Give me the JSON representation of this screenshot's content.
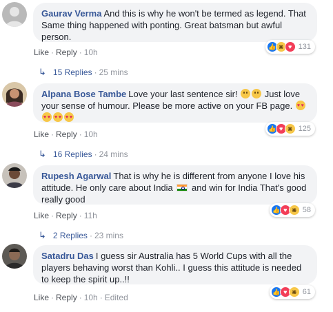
{
  "comments": [
    {
      "name": "Gaurav Verma",
      "text": "And this is why he won't be termed as legend. That Same thing happened with ponting. Great batsman but awful person.",
      "like": "Like",
      "reply": "Reply",
      "time": "10h",
      "edited": "",
      "reaction_count": "131",
      "reaction_icons": [
        "like-icon",
        "haha-icon",
        "love-icon"
      ],
      "replies_label": "15 Replies",
      "replies_time": "25 mins"
    },
    {
      "name": "Alpana Bose Tambe",
      "text_a": "Love your last sentence sir!",
      "text_b": "Just love your sense of humour. Please be more active on your FB page.",
      "like": "Like",
      "reply": "Reply",
      "time": "10h",
      "edited": "",
      "reaction_count": "125",
      "reaction_icons": [
        "like-icon",
        "love-icon",
        "haha-icon"
      ],
      "replies_label": "16 Replies",
      "replies_time": "24 mins"
    },
    {
      "name": "Rupesh Agarwal",
      "text_a": "That is why he is different from anyone I love his attitude. He only care about India",
      "text_b": "and win for India That's good really good",
      "like": "Like",
      "reply": "Reply",
      "time": "11h",
      "edited": "",
      "reaction_count": "58",
      "reaction_icons": [
        "like-icon",
        "love-icon",
        "haha-icon"
      ],
      "replies_label": "2 Replies",
      "replies_time": "23 mins"
    },
    {
      "name": "Satadru Das",
      "text": "I guess sir Australia has 5 World Cups with all the players behaving worst than Kohli.. I guess this attitude is needed to keep the spirit up..!!",
      "like": "Like",
      "reply": "Reply",
      "time": "10h",
      "edited": "Edited",
      "reaction_count": "61",
      "reaction_icons": [
        "like-icon",
        "love-icon",
        "haha-icon"
      ]
    }
  ],
  "colors": {
    "name_link": "#385898",
    "bubble_bg": "#f2f3f5",
    "meta_gray": "#90949c",
    "like_blue": "#1877f2",
    "love_red": "#f33e58",
    "haha_yellow": "#f7c748"
  }
}
